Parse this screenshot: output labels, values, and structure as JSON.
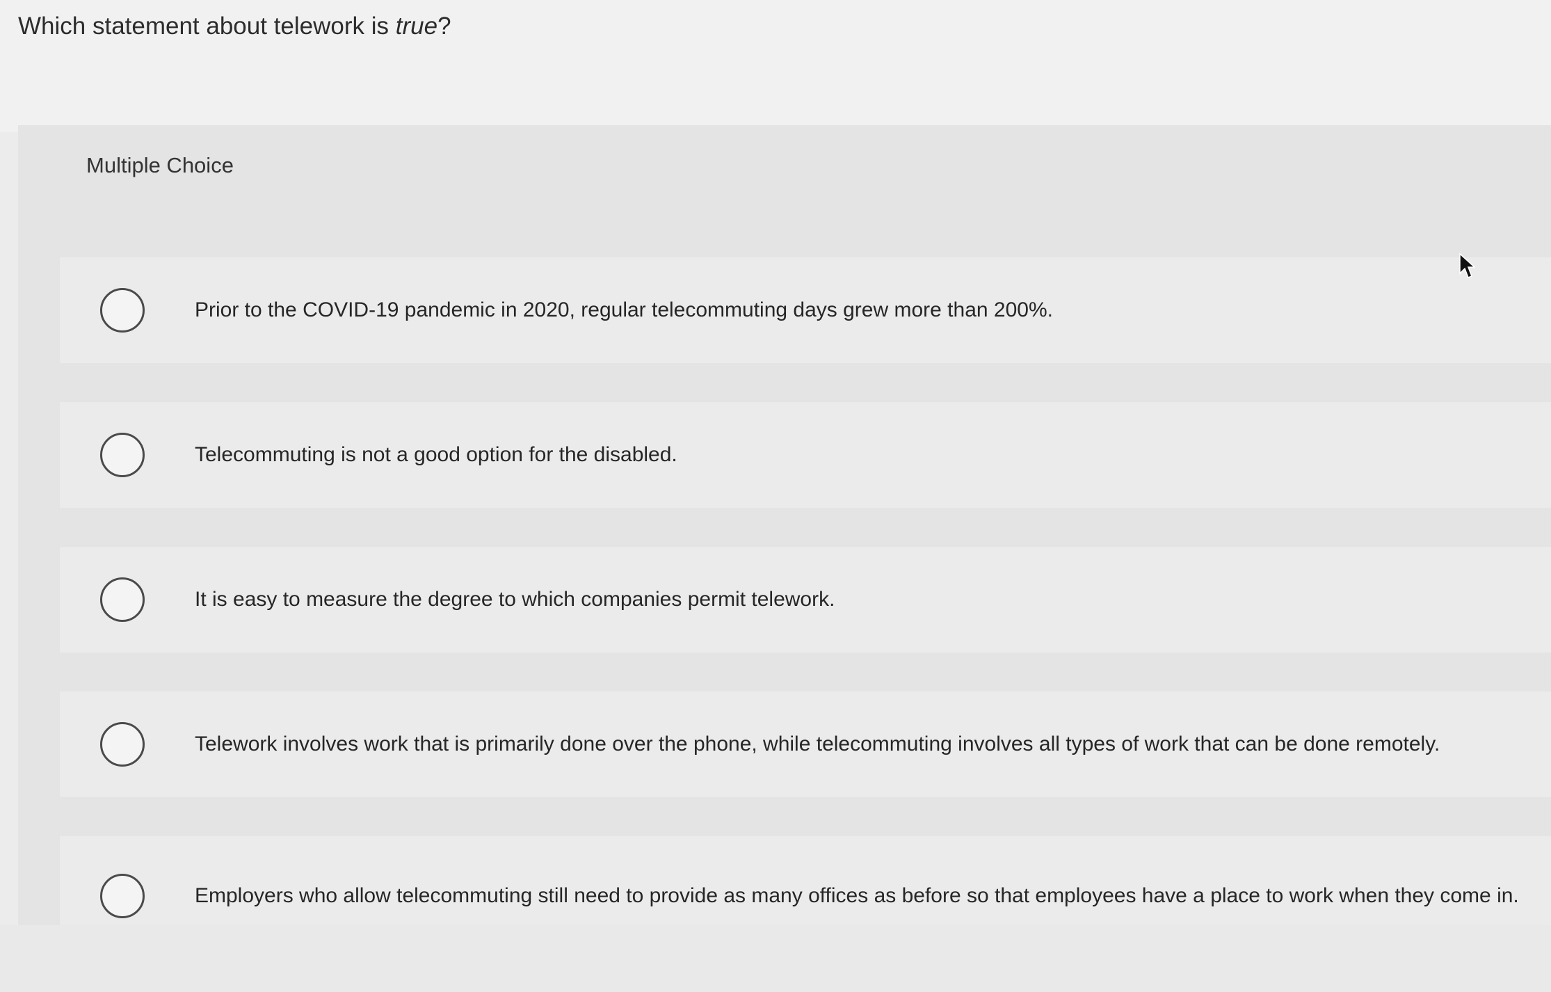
{
  "question": {
    "prefix": "Which statement about telework is ",
    "emphasis": "true",
    "suffix": "?"
  },
  "section_label": "Multiple Choice",
  "options": [
    {
      "text": "Prior to the COVID-19 pandemic in 2020, regular telecommuting days grew more than 200%."
    },
    {
      "text": "Telecommuting is not a good option for the disabled."
    },
    {
      "text": "It is easy to measure the degree to which companies permit telework."
    },
    {
      "text": "Telework involves work that is primarily done over the phone, while telecommuting involves all types of work that can be done remotely."
    },
    {
      "text": "Employers who allow telecommuting still need to provide as many offices as before so that employees have a place to work when they come in."
    }
  ],
  "icons": {
    "radio": "radio-button-unselected-icon",
    "cursor": "mouse-pointer-icon"
  }
}
